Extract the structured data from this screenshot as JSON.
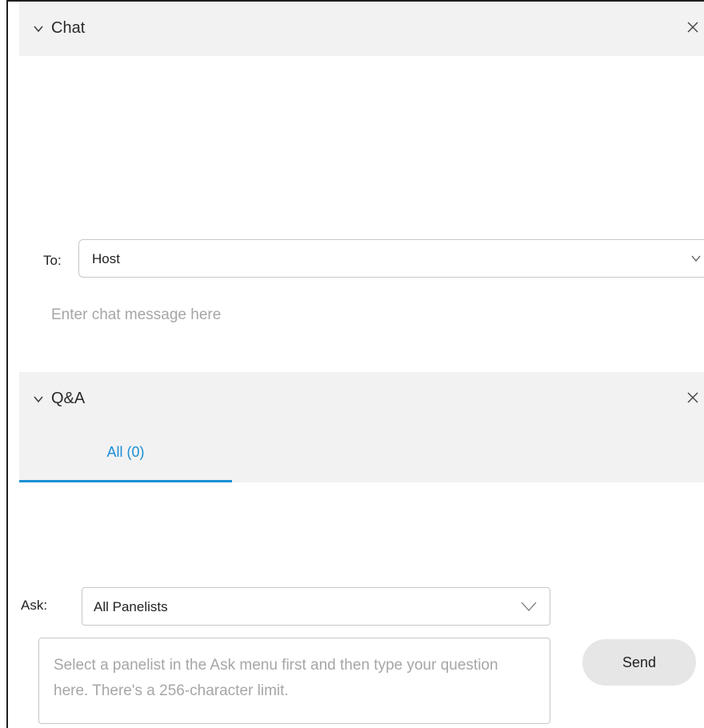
{
  "chat": {
    "title": "Chat",
    "to_label": "To:",
    "to_value": "Host",
    "input_placeholder": "Enter chat message here"
  },
  "qa": {
    "title": "Q&A",
    "tabs": [
      {
        "label": "All (0)",
        "active": true
      }
    ],
    "ask_label": "Ask:",
    "ask_value": "All Panelists",
    "question_placeholder": "Select a panelist in the Ask menu first and then type your question here. There's a 256-character limit.",
    "send_label": "Send"
  },
  "colors": {
    "accent": "#1a8fd6",
    "header_bg": "#f2f2f2",
    "placeholder": "#a6a6a6"
  },
  "icons": {
    "collapse": "chevron-down-icon",
    "close": "close-icon",
    "dropdown": "chevron-down-icon"
  }
}
